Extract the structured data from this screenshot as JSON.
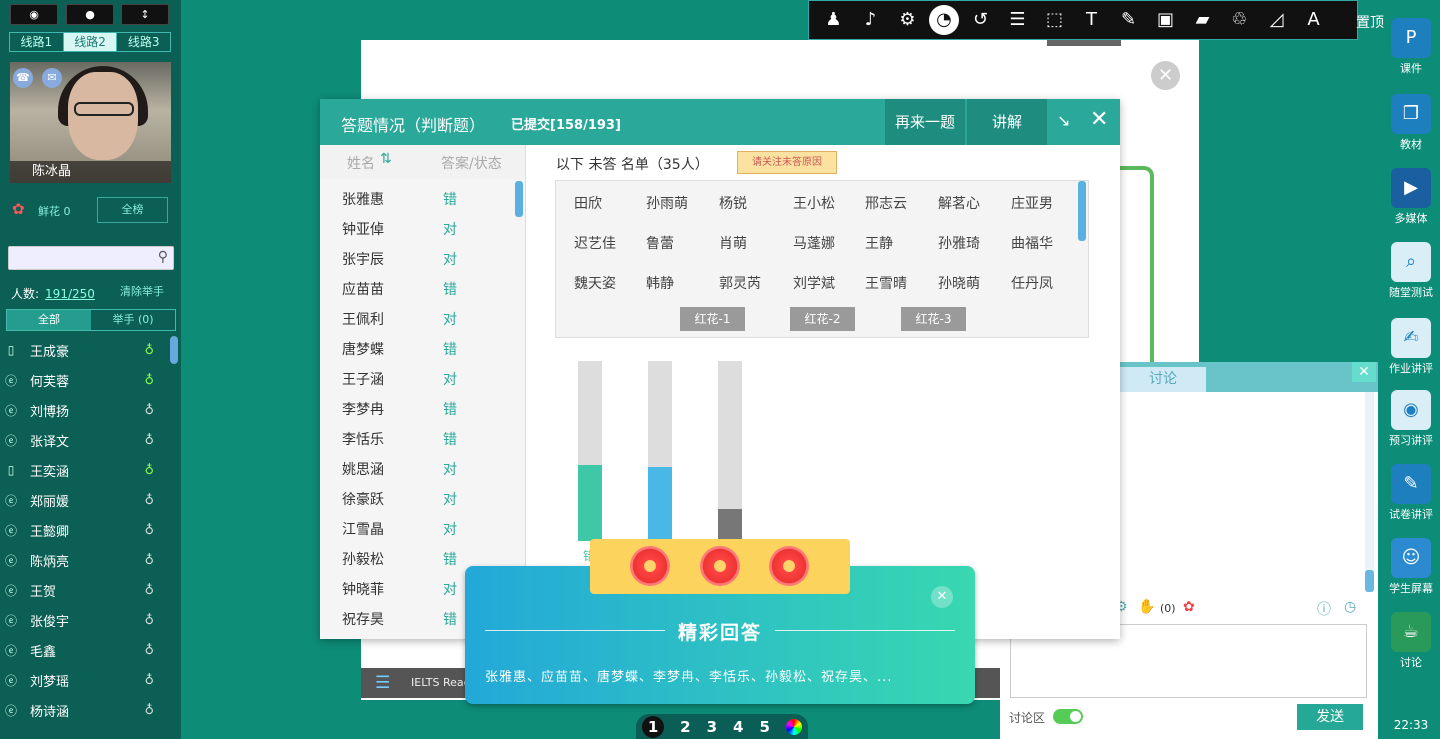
{
  "left": {
    "ctrl_buttons": [
      "◉",
      "●",
      "↕"
    ],
    "lines": [
      "线路1",
      "线路2",
      "线路3"
    ],
    "teacher_name": "陈冰晶",
    "flowers": "鲜花 0",
    "board_btn": "全榜",
    "count_label": "人数:",
    "count_value": "191/250",
    "clear_hands": "清除举手",
    "tab_all": "全部",
    "tab_raise": "举手 (0)",
    "students": [
      "王成豪",
      "何芙蓉",
      "刘博扬",
      "张译文",
      "王奕涵",
      "郑丽媛",
      "王懿卿",
      "陈炳亮",
      "王贺",
      "张俊宇",
      "毛鑫",
      "刘梦瑶",
      "杨诗涵"
    ]
  },
  "toolbar": {
    "tools": [
      "♟",
      "♪",
      "⚙",
      "◔",
      "↺",
      "☰",
      "⬚",
      "T",
      "✎",
      "▣",
      "▰",
      "♲",
      "◿",
      "A"
    ],
    "settings": "置顶"
  },
  "rightbar": [
    "课件",
    "教材",
    "多媒体",
    "随堂测试",
    "作业讲评",
    "预习讲评",
    "试卷讲评",
    "学生屏幕",
    "讨论"
  ],
  "rightbar_time": "22:33",
  "dialog": {
    "title": "答题情况（判断题）",
    "submitted": "已提交[158/193]",
    "btn_again": "再来一题",
    "btn_explain": "讲解",
    "col_name": "姓名",
    "col_answer": "答案/状态",
    "answers": [
      {
        "name": "张雅惠",
        "status": "错"
      },
      {
        "name": "钟亚倬",
        "status": "对"
      },
      {
        "name": "张宇辰",
        "status": "对"
      },
      {
        "name": "应苗苗",
        "status": "错"
      },
      {
        "name": "王佩利",
        "status": "对"
      },
      {
        "name": "唐梦蝶",
        "status": "错"
      },
      {
        "name": "王子涵",
        "status": "对"
      },
      {
        "name": "李梦冉",
        "status": "错"
      },
      {
        "name": "李恬乐",
        "status": "错"
      },
      {
        "name": "姚思涵",
        "status": "对"
      },
      {
        "name": "徐豪跃",
        "status": "对"
      },
      {
        "name": "江雪晶",
        "status": "对"
      },
      {
        "name": "孙毅松",
        "status": "错"
      },
      {
        "name": "钟晓菲",
        "status": "对"
      },
      {
        "name": "祝存昊",
        "status": "错"
      }
    ],
    "unanswered_label": "以下 未答 名单（35人）",
    "notice": "请关注未答原因",
    "unanswered": [
      "田欣",
      "孙雨萌",
      "杨锐",
      "王小松",
      "邢志云",
      "解茗心",
      "庄亚男",
      "迟艺佳",
      "鲁蕾",
      "肖萌",
      "马蓬娜",
      "王静",
      "孙雅琦",
      "曲福华",
      "魏天姿",
      "韩静",
      "郭灵芮",
      "刘学斌",
      "王雪晴",
      "孙晓萌",
      "任丹凤"
    ],
    "tags": [
      "红花-1",
      "红花-2",
      "红花-3"
    ],
    "bars": [
      {
        "fraction": 0.42,
        "color": "#3fc8a8"
      },
      {
        "fraction": 0.41,
        "color": "#4ab8e6"
      },
      {
        "fraction": 0.18,
        "color": "#777777"
      }
    ],
    "bar_label_partial": "错"
  },
  "doc": {
    "title": "IELTS Reac"
  },
  "pager": [
    "1",
    "2",
    "3",
    "4",
    "5"
  ],
  "discussion": {
    "tab": "讨论",
    "hands_count": "(0)",
    "area_label": "讨论区",
    "send": "发送"
  },
  "reward": {
    "title": "精彩回答",
    "names": "张雅惠、应苗苗、唐梦蝶、李梦冉、李恬乐、孙毅松、祝存昊、..."
  }
}
